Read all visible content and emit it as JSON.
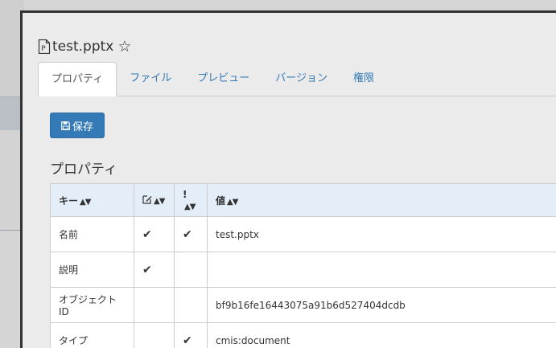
{
  "dialog": {
    "title": "test.pptx"
  },
  "tabs": [
    {
      "label": "プロパティ",
      "active": true
    },
    {
      "label": "ファイル",
      "active": false
    },
    {
      "label": "プレビュー",
      "active": false
    },
    {
      "label": "バージョン",
      "active": false
    },
    {
      "label": "権限",
      "active": false
    }
  ],
  "toolbar": {
    "save_label": "保存"
  },
  "section": {
    "title": "プロパティ"
  },
  "table": {
    "headers": {
      "key": "キー",
      "editable_icon": "edit-icon",
      "required_mark": "!",
      "value": "値"
    },
    "rows": [
      {
        "key": "名前",
        "editable": true,
        "required": true,
        "value": "test.pptx"
      },
      {
        "key": "説明",
        "editable": true,
        "required": false,
        "value": ""
      },
      {
        "key": "オブジェクトID",
        "editable": false,
        "required": false,
        "value": "bf9b16fe16443075a91b6d527404dcdb"
      },
      {
        "key": "タイプ",
        "editable": false,
        "required": true,
        "value": "cmis:document"
      }
    ]
  },
  "glyphs": {
    "check": "✔",
    "sort": "▲▼",
    "star": "☆"
  },
  "colors": {
    "accent": "#337ab7",
    "header_bg": "#e3eef8"
  }
}
